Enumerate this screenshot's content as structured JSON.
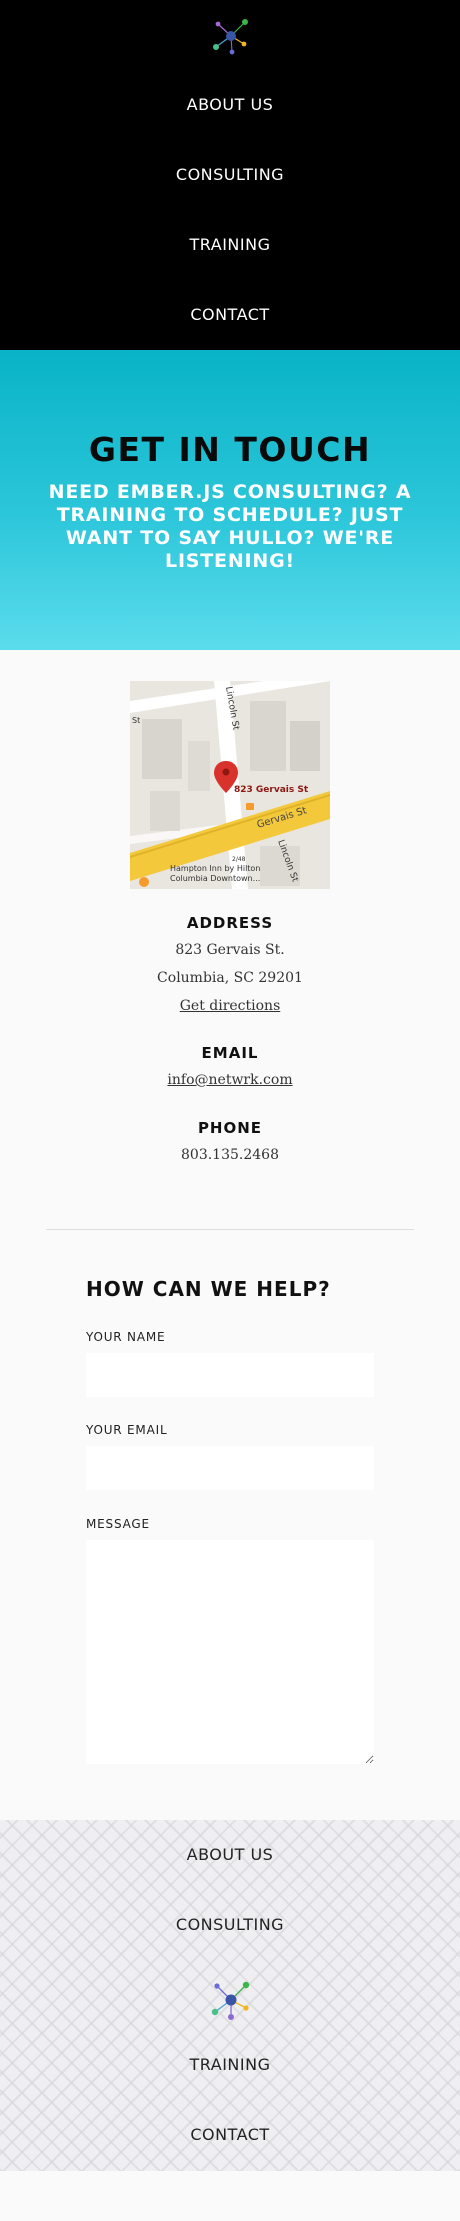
{
  "nav": {
    "items": [
      {
        "label": "ABOUT US"
      },
      {
        "label": "CONSULTING"
      },
      {
        "label": "TRAINING"
      },
      {
        "label": "CONTACT"
      }
    ]
  },
  "logo_icon": "network-nodes-icon",
  "hero": {
    "title": "GET IN TOUCH",
    "tagline": "NEED EMBER.JS CONSULTING? A TRAINING TO SCHEDULE? JUST WANT TO SAY HULLO? WE'RE LISTENING!"
  },
  "map": {
    "marker_label": "823 Gervais St",
    "street_gervais": "Gervais St",
    "street_lincoln_top": "Lincoln St",
    "street_lincoln_bottom": "Lincoln St",
    "street_fragment": "St",
    "route_number": "2/48",
    "poi_label_line1": "Hampton Inn by Hilton",
    "poi_label_line2": "Columbia Downtown..."
  },
  "contact": {
    "address_label": "ADDRESS",
    "address_line1": "823 Gervais St.",
    "address_line2": "Columbia, SC 29201",
    "directions_link": "Get directions",
    "email_label": "EMAIL",
    "email": "info@netwrk.com",
    "phone_label": "PHONE",
    "phone": "803.135.2468"
  },
  "form": {
    "heading": "HOW CAN WE HELP?",
    "name_label": "YOUR NAME",
    "name_value": "",
    "email_label": "YOUR EMAIL",
    "email_value": "",
    "message_label": "MESSAGE",
    "message_value": ""
  },
  "footer": {
    "items": [
      {
        "label": "ABOUT US"
      },
      {
        "label": "CONSULTING"
      },
      {
        "label": "TRAINING"
      },
      {
        "label": "CONTACT"
      }
    ]
  },
  "colors": {
    "hero_gradient_top": "#09b3c7",
    "hero_gradient_bottom": "#5bdcec",
    "nav_background": "#000000",
    "map_road": "#f3c83a",
    "map_marker": "#d9322c"
  }
}
